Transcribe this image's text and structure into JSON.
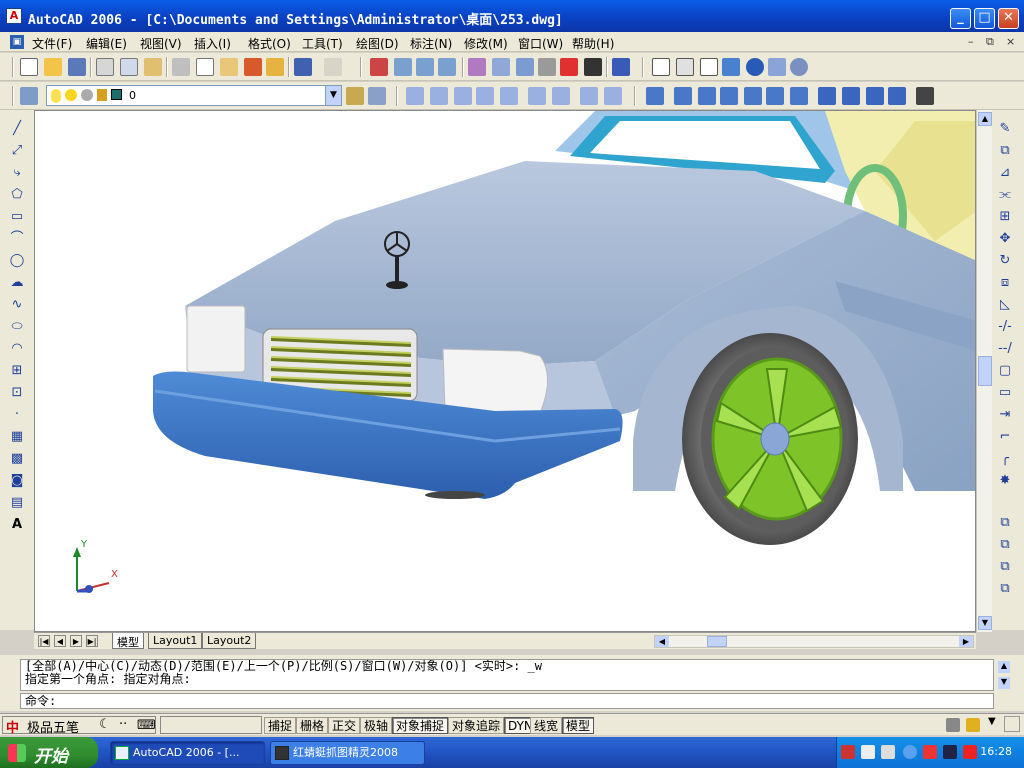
{
  "window": {
    "title": "AutoCAD 2006 - [C:\\Documents and Settings\\Administrator\\桌面\\253.dwg]",
    "minimize": "_",
    "maximize": "□",
    "close": "✕"
  },
  "menu": {
    "items": [
      "文件(F)",
      "编辑(E)",
      "视图(V)",
      "插入(I)",
      "格式(O)",
      "工具(T)",
      "绘图(D)",
      "标注(N)",
      "修改(M)",
      "窗口(W)",
      "帮助(H)"
    ],
    "doc_min": "–",
    "doc_restore": "⧉",
    "doc_close": "×"
  },
  "layer": {
    "current": "0"
  },
  "tabs": {
    "items": [
      "模型",
      "Layout1",
      "Layout2"
    ]
  },
  "command": {
    "line1": "[全部(A)/中心(C)/动态(D)/范围(E)/上一个(P)/比例(S)/窗口(W)/对象(O)] <实时>: _w",
    "line2": "指定第一个角点: 指定对角点:",
    "prompt": "命令:"
  },
  "ucs": {
    "x_label": "X",
    "y_label": "Y"
  },
  "status": {
    "ime_label": "极品五笔",
    "buttons": [
      "捕捉",
      "栅格",
      "正交",
      "极轴",
      "对象捕捉",
      "对象追踪",
      "DYN",
      "线宽",
      "模型"
    ],
    "active_buttons": [
      "对象捕捉",
      "DYN",
      "模型"
    ]
  },
  "taskbar": {
    "start": "开始",
    "tasks": [
      "AutoCAD 2006 - [...",
      "红蜻蜓抓图精灵2008"
    ],
    "clock": "16:28"
  },
  "colors": {
    "titlebar": "#0a4fd8",
    "car_body": "#a6b8d0",
    "bumper": "#3f7ac8",
    "rim": "#7ec428"
  }
}
